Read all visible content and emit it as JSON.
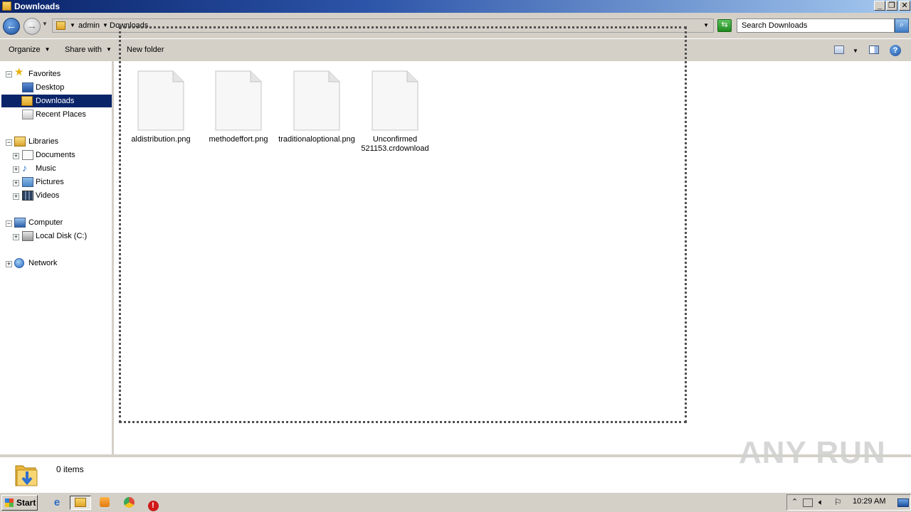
{
  "window": {
    "title": "Downloads"
  },
  "address": {
    "crumbs": [
      "admin",
      "Downloads"
    ],
    "search_placeholder": "Search Downloads"
  },
  "toolbar": {
    "organize": "Organize",
    "share_with": "Share with",
    "new_folder": "New folder"
  },
  "nav": {
    "favorites": {
      "label": "Favorites",
      "items": [
        "Desktop",
        "Downloads",
        "Recent Places"
      ]
    },
    "libraries": {
      "label": "Libraries",
      "items": [
        "Documents",
        "Music",
        "Pictures",
        "Videos"
      ]
    },
    "computer": {
      "label": "Computer",
      "items": [
        "Local Disk (C:)"
      ]
    },
    "network": {
      "label": "Network"
    },
    "selected": "Downloads"
  },
  "files": [
    {
      "name": "aldistribution.png",
      "icon": "blank-file-icon"
    },
    {
      "name": "methodeffort.png",
      "icon": "blank-file-icon"
    },
    {
      "name": "traditionaloptional.png",
      "icon": "blank-file-icon"
    },
    {
      "name": "Unconfirmed 521153.crdownload",
      "icon": "blank-file-icon"
    }
  ],
  "details": {
    "count": "0 items"
  },
  "watermark": "ANY RUN",
  "taskbar": {
    "start": "Start",
    "clock": "10:29 AM"
  },
  "colors": {
    "selection": "#0a246a",
    "titlebar_start": "#0a246a",
    "titlebar_end": "#a6caf0"
  }
}
